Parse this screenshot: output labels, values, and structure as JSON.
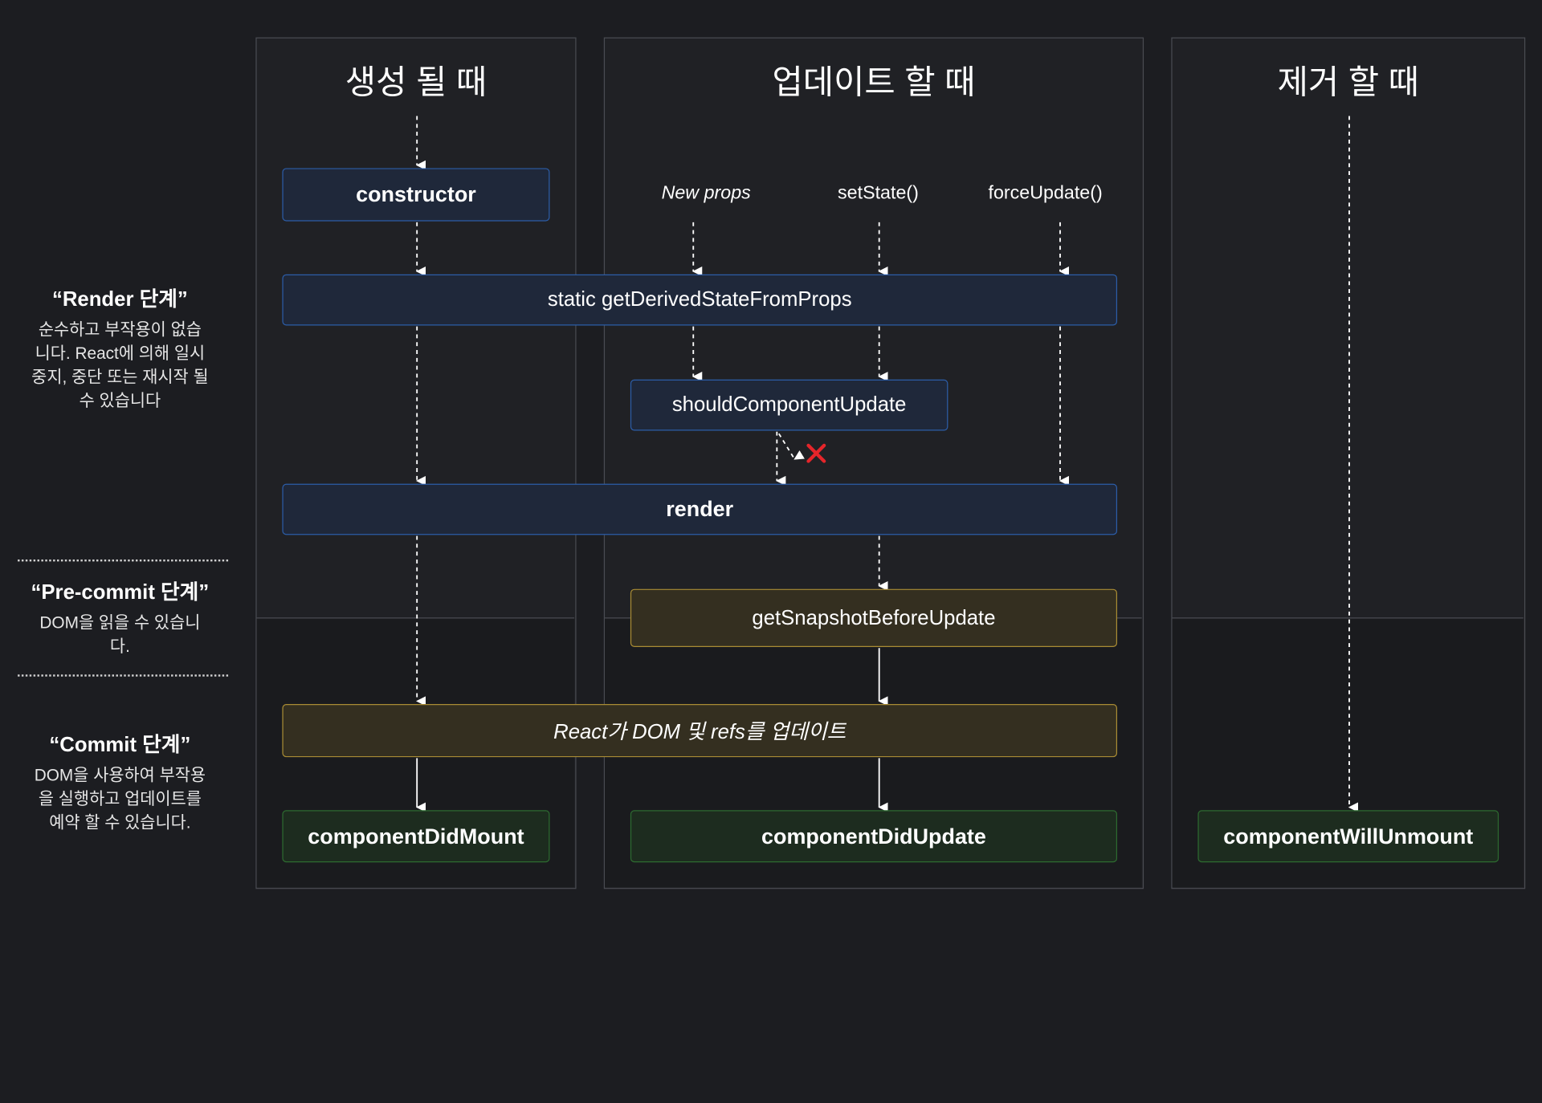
{
  "columns": {
    "mount": {
      "title": "생성 될 때"
    },
    "update": {
      "title": "업데이트 할 때"
    },
    "unmount": {
      "title": "제거 할 때"
    }
  },
  "phases": {
    "render": {
      "title": "“Render 단계”",
      "desc_lines": [
        "순수하고 부작용이 없습",
        "니다. React에 의해 일시",
        "중지, 중단 또는 재시작 될",
        "수 있습니다"
      ]
    },
    "precommit": {
      "title": "“Pre-commit 단계”",
      "desc_lines": [
        "DOM을 읽을 수 있습니",
        "다."
      ]
    },
    "commit": {
      "title": "“Commit 단계”",
      "desc_lines": [
        "DOM을 사용하여 부작용",
        "을 실행하고 업데이트를",
        "예약 할 수 있습니다."
      ]
    }
  },
  "triggers": {
    "new_props": "New props",
    "set_state": "setState()",
    "force_update": "forceUpdate()"
  },
  "methods": {
    "constructor": "constructor",
    "get_derived_state": "static getDerivedStateFromProps",
    "should_update": "shouldComponentUpdate",
    "render": "render",
    "snapshot": "getSnapshotBeforeUpdate",
    "react_updates_dom": "React가 DOM 및 refs를 업데이트",
    "did_mount": "componentDidMount",
    "did_update": "componentDidUpdate",
    "will_unmount": "componentWillUnmount"
  },
  "colors": {
    "background": "#1c1d21",
    "render_phase_box_border": "#2c5da8",
    "commit_box_border": "#a98c34",
    "lifecycle_end_box_border": "#2d6b30",
    "cancel_mark": "#e5252a"
  }
}
